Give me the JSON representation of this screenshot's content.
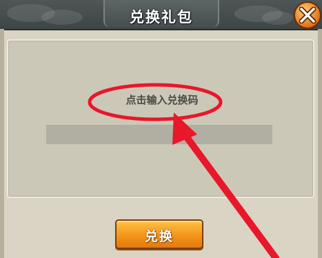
{
  "dialog": {
    "title": "兑换礼包",
    "close_icon": "close-icon"
  },
  "input": {
    "prompt": "点击输入兑换码"
  },
  "redeem_button": {
    "label": "兑换"
  },
  "colors": {
    "header": "#474e4e",
    "panel": "#ccc8b8",
    "button": "#f3951b",
    "annotation": "#e8172a"
  }
}
